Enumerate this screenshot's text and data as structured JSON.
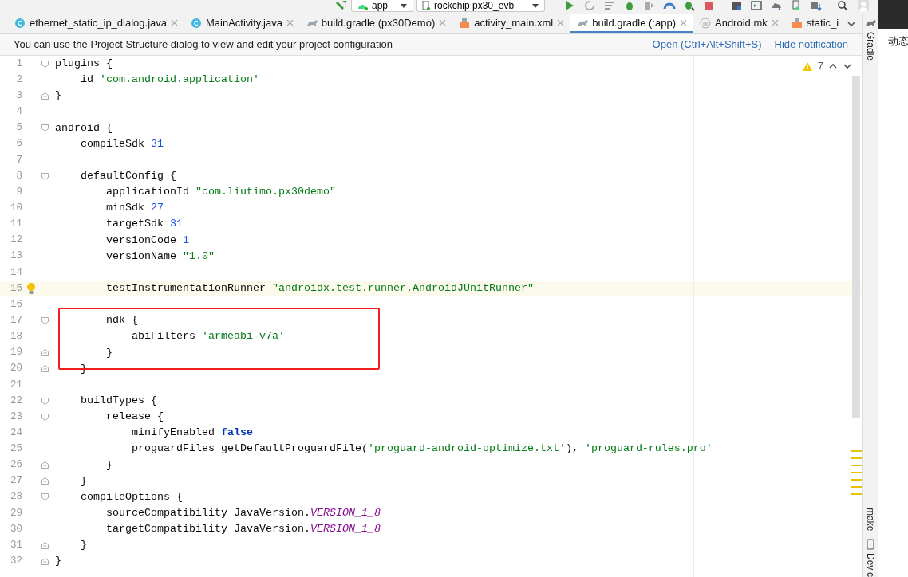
{
  "toolbar": {
    "config": "app",
    "device": "rockchip px30_evb"
  },
  "tabs": [
    {
      "label": "ethernet_static_ip_dialog.java",
      "kind": "class",
      "selected": false
    },
    {
      "label": "MainActivity.java",
      "kind": "class",
      "selected": false
    },
    {
      "label": "build.gradle (px30Demo)",
      "kind": "gradle",
      "selected": false
    },
    {
      "label": "activity_main.xml",
      "kind": "xml",
      "selected": false
    },
    {
      "label": "build.gradle (:app)",
      "kind": "gradle",
      "selected": true
    },
    {
      "label": "Android.mk",
      "kind": "make",
      "selected": false
    },
    {
      "label": "static_i",
      "kind": "xml",
      "selected": false
    }
  ],
  "notification": {
    "message": "You can use the Project Structure dialog to view and edit your project configuration",
    "actions": [
      "Open (Ctrl+Alt+Shift+S)",
      "Hide notification"
    ]
  },
  "inspections": {
    "warnings": "7"
  },
  "lines": [
    {
      "number": "1",
      "kind": "opener",
      "tokens": [
        {
          "t": "plugins {",
          "kind": "plain"
        }
      ]
    },
    {
      "number": "2",
      "kind": "plain",
      "tokens": [
        {
          "t": "id ",
          "kind": "plain"
        },
        {
          "t": "'com.android.application'",
          "kind": "string"
        }
      ]
    },
    {
      "number": "3",
      "kind": "closer",
      "tokens": [
        {
          "t": "}",
          "kind": "plain"
        }
      ]
    },
    {
      "number": "4",
      "kind": "plain"
    },
    {
      "number": "5",
      "kind": "opener",
      "tokens": [
        {
          "t": "android {",
          "kind": "plain"
        }
      ]
    },
    {
      "number": "6",
      "kind": "plain",
      "tokens": [
        {
          "t": "compileSdk ",
          "kind": "plain"
        },
        {
          "t": "31",
          "kind": "number"
        }
      ]
    },
    {
      "number": "7",
      "kind": "plain"
    },
    {
      "number": "8",
      "kind": "opener",
      "tokens": [
        {
          "t": "defaultConfig {",
          "kind": "plain"
        }
      ]
    },
    {
      "number": "9",
      "kind": "plain",
      "tokens": [
        {
          "t": "applicationId ",
          "kind": "plain"
        },
        {
          "t": "\"com.liutimo.px30demo\"",
          "kind": "string"
        }
      ]
    },
    {
      "number": "10",
      "kind": "plain",
      "tokens": [
        {
          "t": "minSdk ",
          "kind": "plain"
        },
        {
          "t": "27",
          "kind": "number"
        }
      ]
    },
    {
      "number": "11",
      "kind": "plain",
      "tokens": [
        {
          "t": "targetSdk ",
          "kind": "plain"
        },
        {
          "t": "31",
          "kind": "number"
        }
      ]
    },
    {
      "number": "12",
      "kind": "plain",
      "tokens": [
        {
          "t": "versionCode ",
          "kind": "plain"
        },
        {
          "t": "1",
          "kind": "number"
        }
      ]
    },
    {
      "number": "13",
      "kind": "plain",
      "tokens": [
        {
          "t": "versionName ",
          "kind": "plain"
        },
        {
          "t": "\"1.0\"",
          "kind": "string"
        }
      ]
    },
    {
      "number": "14",
      "kind": "plain"
    },
    {
      "number": "15",
      "kind": "plain",
      "current": true,
      "hint": true,
      "tokens": [
        {
          "t": "testInstrumentationRunner ",
          "kind": "plain"
        },
        {
          "t": "\"androidx.test.runner.AndroidJUnitRunner\"",
          "kind": "string"
        }
      ]
    },
    {
      "number": "16",
      "kind": "plain"
    },
    {
      "number": "17",
      "kind": "opener",
      "tokens": [
        {
          "t": "ndk {",
          "kind": "plain"
        }
      ]
    },
    {
      "number": "18",
      "kind": "plain",
      "tokens": [
        {
          "t": "abiFilters ",
          "kind": "plain"
        },
        {
          "t": "'armeabi-v7a'",
          "kind": "string"
        }
      ]
    },
    {
      "number": "19",
      "kind": "closer",
      "tokens": [
        {
          "t": "}",
          "kind": "plain"
        }
      ]
    },
    {
      "number": "20",
      "kind": "closer",
      "tokens": [
        {
          "t": "}",
          "kind": "plain"
        }
      ]
    },
    {
      "number": "21",
      "kind": "plain"
    },
    {
      "number": "22",
      "kind": "opener",
      "tokens": [
        {
          "t": "buildTypes {",
          "kind": "plain"
        }
      ]
    },
    {
      "number": "23",
      "kind": "opener",
      "tokens": [
        {
          "t": "release {",
          "kind": "plain"
        }
      ]
    },
    {
      "number": "24",
      "kind": "plain",
      "tokens": [
        {
          "t": "minifyEnabled ",
          "kind": "plain"
        },
        {
          "t": "false",
          "kind": "keyword"
        }
      ]
    },
    {
      "number": "25",
      "kind": "plain",
      "tokens": [
        {
          "t": "proguardFiles getDefaultProguardFile(",
          "kind": "plain"
        },
        {
          "t": "'proguard-android-optimize.txt'",
          "kind": "string"
        },
        {
          "t": "), ",
          "kind": "plain"
        },
        {
          "t": "'proguard-rules.pro'",
          "kind": "string"
        }
      ]
    },
    {
      "number": "26",
      "kind": "closer",
      "tokens": [
        {
          "t": "}",
          "kind": "plain"
        }
      ]
    },
    {
      "number": "27",
      "kind": "closer",
      "tokens": [
        {
          "t": "}",
          "kind": "plain"
        }
      ]
    },
    {
      "number": "28",
      "kind": "opener",
      "tokens": [
        {
          "t": "compileOptions {",
          "kind": "plain"
        }
      ]
    },
    {
      "number": "29",
      "kind": "plain",
      "tokens": [
        {
          "t": "sourceCompatibility JavaVersion.",
          "kind": "plain"
        },
        {
          "t": "VERSION_1_8",
          "kind": "constant"
        }
      ]
    },
    {
      "number": "30",
      "kind": "plain",
      "tokens": [
        {
          "t": "targetCompatibility JavaVersion.",
          "kind": "plain"
        },
        {
          "t": "VERSION_1_8",
          "kind": "constant"
        }
      ]
    },
    {
      "number": "31",
      "kind": "closer",
      "tokens": [
        {
          "t": "}",
          "kind": "plain"
        }
      ]
    },
    {
      "number": "32",
      "kind": "closer",
      "tokens": [
        {
          "t": "}",
          "kind": "plain"
        }
      ]
    }
  ],
  "side_tools": [
    "Gradle",
    "make",
    "Devic"
  ],
  "browser": {
    "text": "动态"
  }
}
